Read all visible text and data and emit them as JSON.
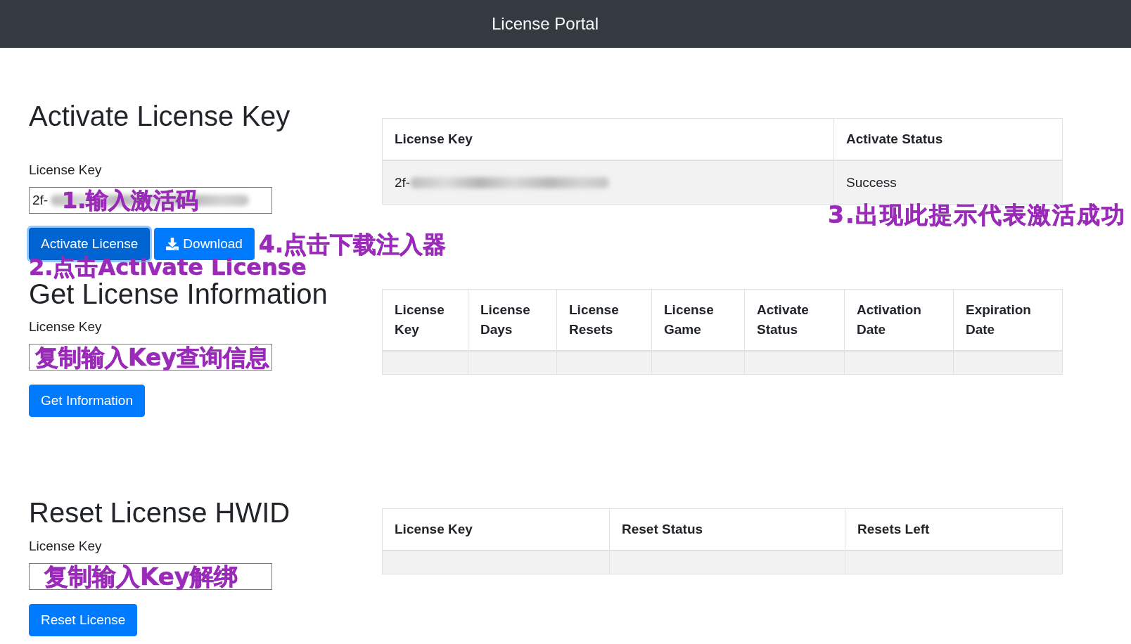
{
  "navbar": {
    "title": "License Portal"
  },
  "sections": [
    {
      "heading": "Activate License Key",
      "field": {
        "label": "License Key",
        "value": "2f-",
        "redacted": true,
        "annotation": "1.输入激活码"
      },
      "buttons": [
        {
          "label": "Activate License",
          "kind": "text",
          "focused": true
        },
        {
          "label": "Download",
          "kind": "icon",
          "focused": false
        }
      ],
      "button_annotations": [
        {
          "kind": "beside",
          "text": "4.点击下载注入器"
        },
        {
          "kind": "below",
          "text": "2.点击Activate License"
        }
      ],
      "table": {
        "columns": [
          "License Key",
          "Activate Status"
        ],
        "rows": [
          {
            "cells": [
              {
                "text": "2f-",
                "redacted": true
              },
              {
                "text": "Success",
                "redacted": false
              }
            ]
          }
        ],
        "annotation": "3.出现此提示代表激活成功"
      }
    },
    {
      "heading": "Get License Information",
      "field": {
        "label": "License Key",
        "annotation": "复制输入Key查询信息"
      },
      "buttons": [
        {
          "label": "Get Information",
          "kind": "text",
          "focused": false
        }
      ],
      "table": {
        "columns": [
          "License Key",
          "License Days",
          "License Resets",
          "License Game",
          "Activate Status",
          "Activation Date",
          "Expiration Date"
        ]
      }
    },
    {
      "heading": "Reset License HWID",
      "field": {
        "label": "License Key",
        "annotation": "复制输入Key解绑"
      },
      "buttons": [
        {
          "label": "Reset License",
          "kind": "text",
          "focused": false
        }
      ],
      "table": {
        "columns": [
          "License Key",
          "Reset Status",
          "Resets Left"
        ]
      }
    }
  ]
}
